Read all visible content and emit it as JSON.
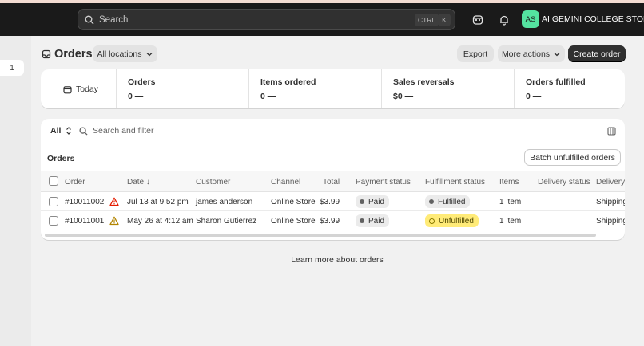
{
  "topbar": {
    "search_placeholder": "Search",
    "shortcut_keys": [
      "CTRL",
      "K"
    ],
    "avatar_initials": "AS",
    "store_name": "AI GEMINI COLLEGE STORE"
  },
  "leftbar": {
    "badge": "1"
  },
  "page": {
    "title": "Orders",
    "location_filter": "All locations",
    "actions": {
      "export": "Export",
      "more_actions": "More actions",
      "create_order": "Create order"
    }
  },
  "stats": {
    "period": "Today",
    "items": [
      {
        "label": "Orders",
        "value": "0 —"
      },
      {
        "label": "Items ordered",
        "value": "0 —"
      },
      {
        "label": "Sales reversals",
        "value": "$0 —"
      },
      {
        "label": "Orders fulfilled",
        "value": "0 —"
      }
    ]
  },
  "table": {
    "view_tab": "All",
    "search_placeholder": "Search and filter",
    "section_title": "Orders",
    "batch_button": "Batch unfulfilled orders",
    "columns": [
      "Order",
      "Date ↓",
      "Customer",
      "Channel",
      "Total",
      "Payment status",
      "Fulfillment status",
      "Items",
      "Delivery status",
      "Delivery"
    ],
    "rows": [
      {
        "order": "#10011002",
        "alert": "red",
        "date": "Jul 13 at 9:52 pm",
        "customer": "james anderson",
        "channel": "Online Store",
        "total": "$3.99",
        "payment_status": "Paid",
        "fulfillment_status": "Fulfilled",
        "items": "1 item",
        "delivery_status": "",
        "delivery": "Shipping"
      },
      {
        "order": "#10011001",
        "alert": "yellow",
        "date": "May 26 at 4:12 am",
        "customer": "Sharon Gutierrez",
        "channel": "Online Store",
        "total": "$3.99",
        "payment_status": "Paid",
        "fulfillment_status": "Unfulfilled",
        "items": "1 item",
        "delivery_status": "",
        "delivery": "Shipping"
      }
    ]
  },
  "footer": {
    "learn_more": "Learn more about orders"
  },
  "colors": {
    "topbar": "#1a1a1a",
    "avatar": "#54e3a0",
    "primary_button": "#303030",
    "unfulfilled_badge": "#ffeb78",
    "alert_red": "#e51c00",
    "alert_yellow": "#b28400"
  }
}
